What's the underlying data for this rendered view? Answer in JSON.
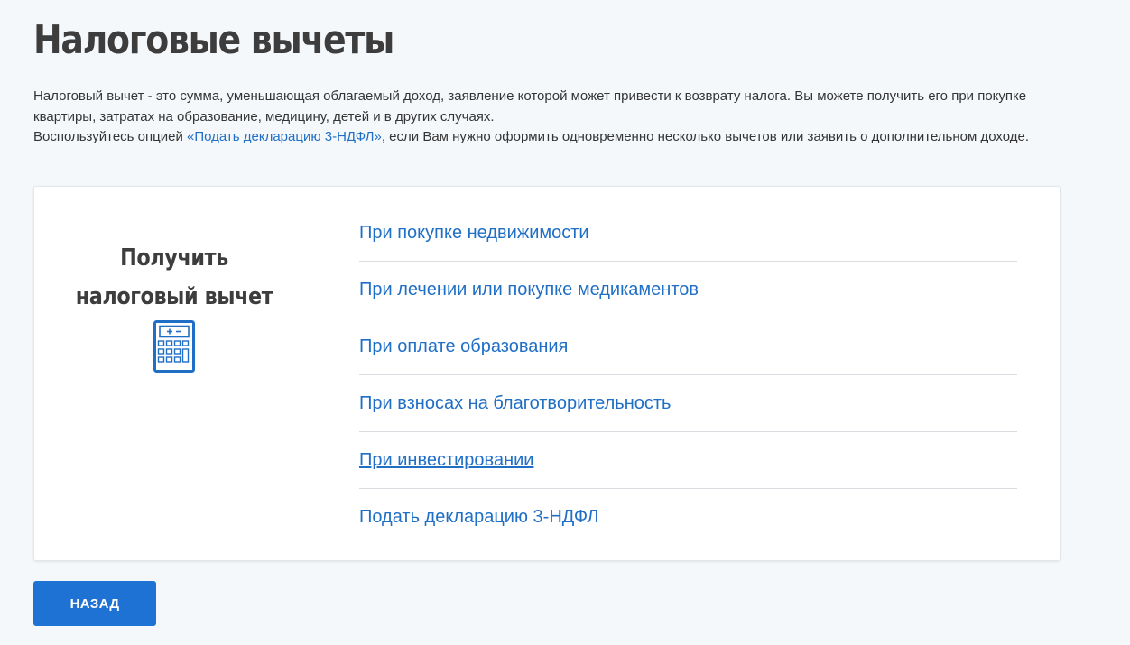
{
  "page": {
    "title": "Налоговые вычеты"
  },
  "intro": {
    "line1": "Налоговый вычет - это сумма, уменьшающая облагаемый доход, заявление которой может привести к возврату налога. Вы можете получить его при покупке квартиры, затратах на образование, медицину, детей и в других случаях.",
    "line2_before": "Воспользуйтесь опцией ",
    "line2_link": "«Подать декларацию 3-НДФЛ»",
    "line2_after": ", если Вам нужно оформить одновременно несколько вычетов или заявить о дополнительном доходе."
  },
  "card": {
    "title_line1": "Получить",
    "title_line2": "налоговый вычет",
    "icon": "calculator-icon",
    "links": [
      "При покупке недвижимости",
      "При лечении или покупке медикаментов",
      "При оплате образования",
      "При взносах на благотворительность",
      "При инвестировании",
      "Подать декларацию 3-НДФЛ"
    ]
  },
  "buttons": {
    "back_label": "НАЗАД"
  },
  "colors": {
    "background": "#f5f8fb",
    "link": "#1f6fc6",
    "button": "#1e72d3",
    "text": "#343434"
  }
}
